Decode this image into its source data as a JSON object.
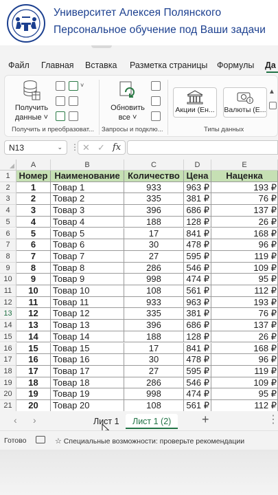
{
  "banner": {
    "line1": "Университет Алексея Полянского",
    "line2": "Персональное обучение под Ваши задачи"
  },
  "ribbon_tabs": [
    "Файл",
    "Главная",
    "Вставка",
    "Разметка страницы",
    "Формулы",
    "Да"
  ],
  "ribbon": {
    "get_data_label1": "Получить",
    "get_data_label2": "данные ˅",
    "group1_label": "Получить и преобразоват...",
    "refresh_label1": "Обновить",
    "refresh_label2": "все ˅",
    "group2_label": "Запросы и подклю...",
    "stocks_label": "Акции (Ен...",
    "currencies_label": "Валюты (Е...",
    "group3_label": "Типы данных"
  },
  "formula_bar": {
    "name_box": "N13",
    "fx": "fx",
    "cancel": "✕",
    "enter": "✓"
  },
  "columns": [
    "A",
    "B",
    "C",
    "D",
    "E"
  ],
  "row_numbers": [
    1,
    2,
    3,
    4,
    5,
    6,
    7,
    8,
    9,
    10,
    11,
    12,
    13,
    14,
    15,
    16,
    17,
    18,
    19,
    20,
    21
  ],
  "table": {
    "headers": [
      "Номер",
      "Наименование",
      "Количество",
      "Цена",
      "Наценка"
    ],
    "rows": [
      [
        "1",
        "Товар 1",
        "933",
        "963 ₽",
        "193 ₽"
      ],
      [
        "2",
        "Товар 2",
        "335",
        "381 ₽",
        "76 ₽"
      ],
      [
        "3",
        "Товар 3",
        "396",
        "686 ₽",
        "137 ₽"
      ],
      [
        "4",
        "Товар 4",
        "188",
        "128 ₽",
        "26 ₽"
      ],
      [
        "5",
        "Товар 5",
        "17",
        "841 ₽",
        "168 ₽"
      ],
      [
        "6",
        "Товар 6",
        "30",
        "478 ₽",
        "96 ₽"
      ],
      [
        "7",
        "Товар 7",
        "27",
        "595 ₽",
        "119 ₽"
      ],
      [
        "8",
        "Товар 8",
        "286",
        "546 ₽",
        "109 ₽"
      ],
      [
        "9",
        "Товар 9",
        "998",
        "474 ₽",
        "95 ₽"
      ],
      [
        "10",
        "Товар 10",
        "108",
        "561 ₽",
        "112 ₽"
      ],
      [
        "11",
        "Товар 11",
        "933",
        "963 ₽",
        "193 ₽"
      ],
      [
        "12",
        "Товар 12",
        "335",
        "381 ₽",
        "76 ₽"
      ],
      [
        "13",
        "Товар 13",
        "396",
        "686 ₽",
        "137 ₽"
      ],
      [
        "14",
        "Товар 14",
        "188",
        "128 ₽",
        "26 ₽"
      ],
      [
        "15",
        "Товар 15",
        "17",
        "841 ₽",
        "168 ₽"
      ],
      [
        "16",
        "Товар 16",
        "30",
        "478 ₽",
        "96 ₽"
      ],
      [
        "17",
        "Товар 17",
        "27",
        "595 ₽",
        "119 ₽"
      ],
      [
        "18",
        "Товар 18",
        "286",
        "546 ₽",
        "109 ₽"
      ],
      [
        "19",
        "Товар 19",
        "998",
        "474 ₽",
        "95 ₽"
      ],
      [
        "20",
        "Товар 20",
        "108",
        "561 ₽",
        "112 ₽"
      ]
    ]
  },
  "sheets": [
    "Лист 1",
    "Лист 1 (2)"
  ],
  "active_sheet": "Лист 1 (2)",
  "status": {
    "ready": "Готово",
    "accessibility": "Специальные возможности: проверьте рекомендации"
  },
  "colors": {
    "brand": "#1b3f8f",
    "header_fill": "#c6e0b4",
    "accent": "#217346"
  }
}
